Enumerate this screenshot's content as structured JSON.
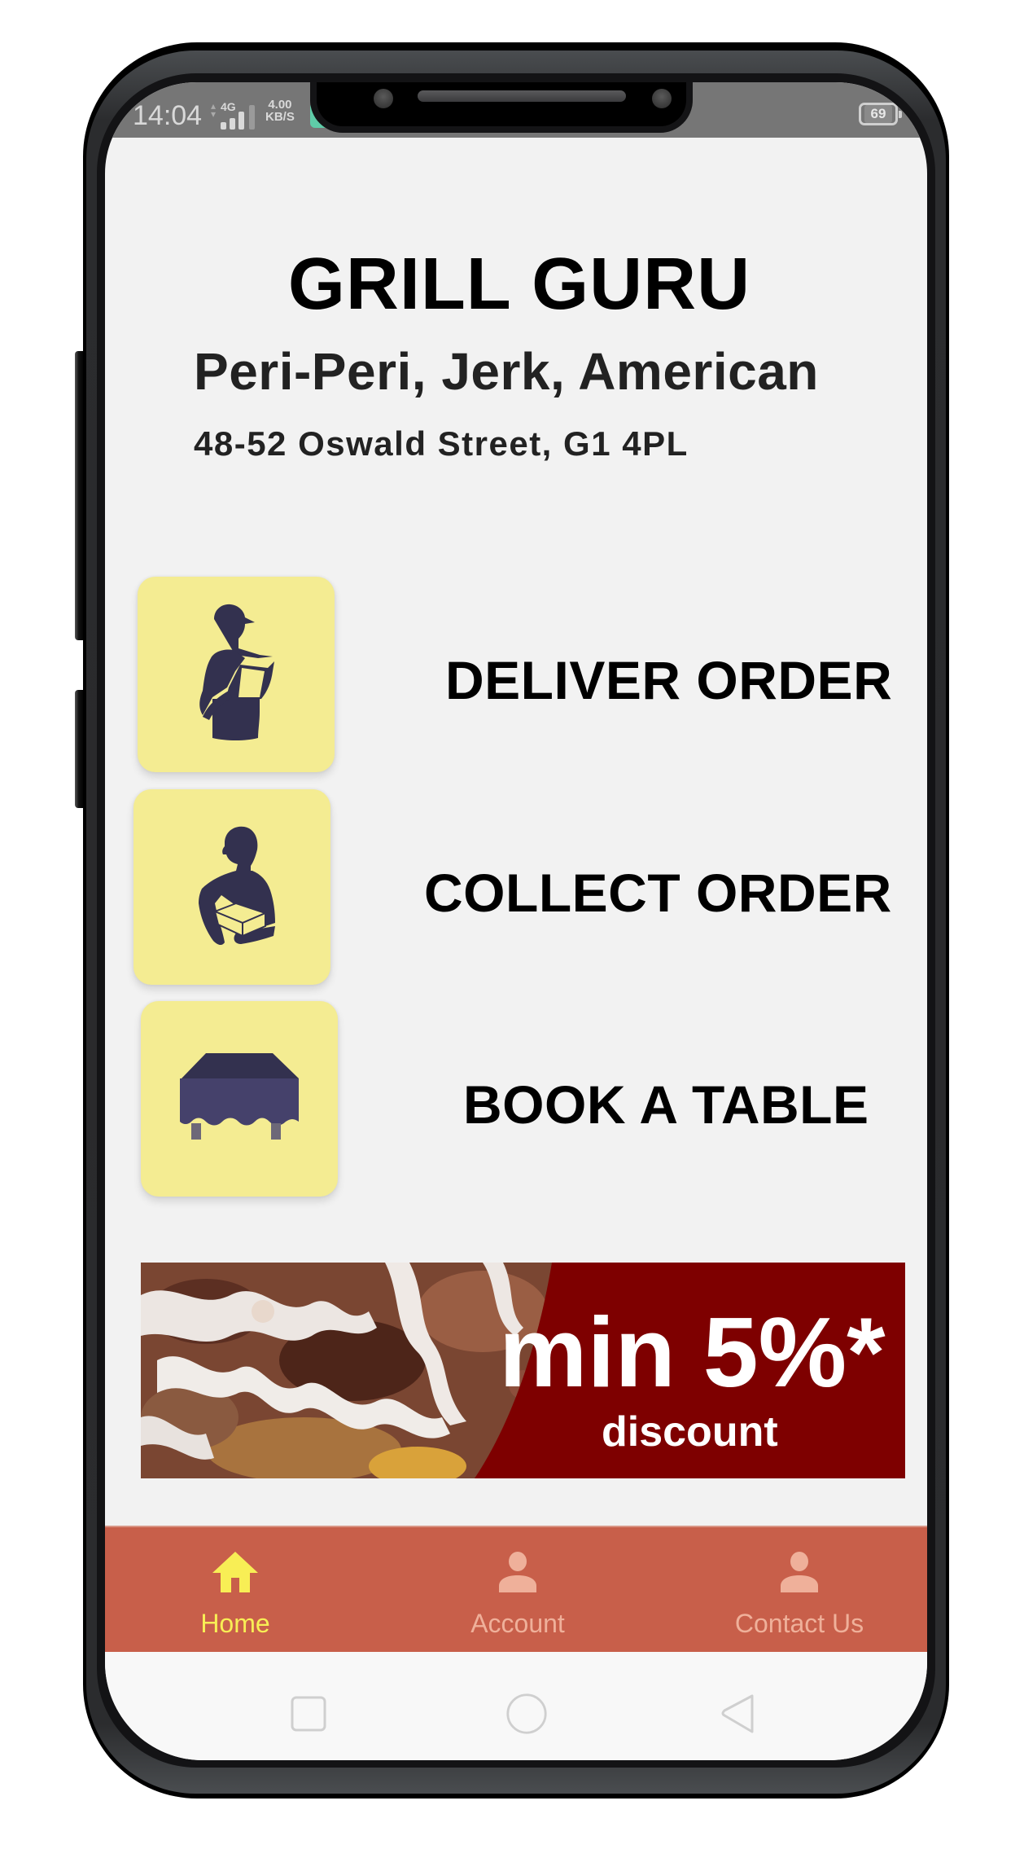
{
  "status_bar": {
    "time": "14:04",
    "network": "4G",
    "speed_value": "4.00",
    "speed_unit": "KB/S",
    "battery": "69"
  },
  "restaurant": {
    "name": "GRILL GURU",
    "cuisines": "Peri-Peri, Jerk, American",
    "address": "48-52 Oswald Street, G1 4PL"
  },
  "actions": [
    {
      "label": "DELIVER ORDER",
      "icon": "delivery-person-icon"
    },
    {
      "label": "COLLECT ORDER",
      "icon": "person-carrying-box-icon"
    },
    {
      "label": "BOOK A TABLE",
      "icon": "table-icon"
    }
  ],
  "banner": {
    "headline": "min 5%*",
    "subtext": "discount"
  },
  "bottom_nav": {
    "items": [
      {
        "label": "Home",
        "icon": "home-icon",
        "active": true
      },
      {
        "label": "Account",
        "icon": "person-icon",
        "active": false
      },
      {
        "label": "Contact Us",
        "icon": "person-icon",
        "active": false
      }
    ]
  },
  "system_nav": {
    "buttons": [
      "recents",
      "home",
      "back"
    ]
  },
  "colors": {
    "tile_bg": "#f4ec92",
    "icon_navy": "#33314f",
    "banner_bg": "#7e0000",
    "nav_bg": "#c85f4a",
    "nav_active": "#f8ee55",
    "nav_inactive": "#efb09a"
  }
}
